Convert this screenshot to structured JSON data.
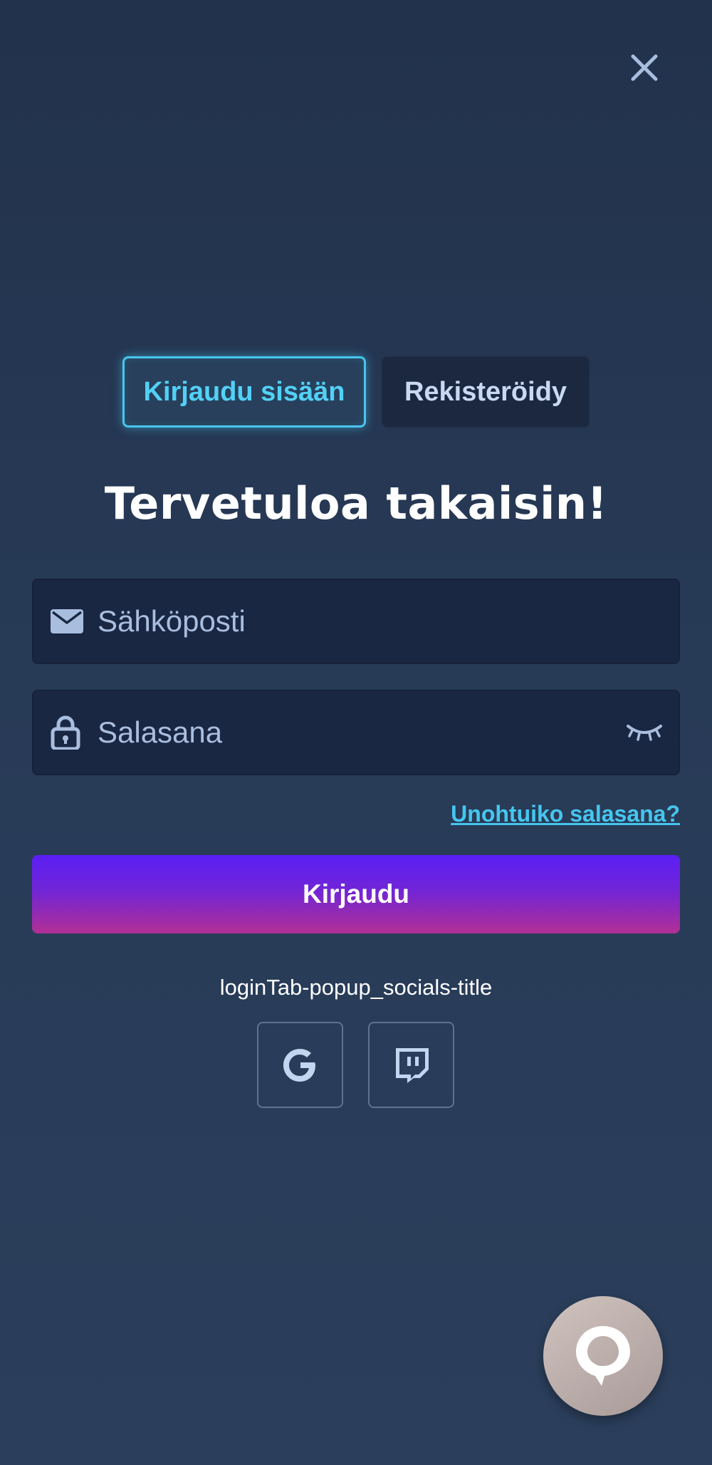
{
  "modal": {
    "close_icon": "close-icon"
  },
  "tabs": [
    {
      "label": "Kirjaudu sisään",
      "active": true
    },
    {
      "label": "Rekisteröidy",
      "active": false
    }
  ],
  "heading": "Tervetuloa takaisin!",
  "form": {
    "email": {
      "placeholder": "Sähköposti",
      "value": "",
      "icon": "envelope-icon"
    },
    "password": {
      "placeholder": "Salasana",
      "value": "",
      "icon": "lock-icon",
      "toggle_icon": "eye-closed-icon"
    },
    "forgot_label": "Unohtuiko salasana?",
    "submit_label": "Kirjaudu"
  },
  "socials": {
    "title": "loginTab-popup_socials-title",
    "providers": [
      {
        "icon": "google-icon"
      },
      {
        "icon": "twitch-icon"
      }
    ]
  },
  "chat": {
    "icon": "chat-icon"
  },
  "colors": {
    "accent": "#46c6ee",
    "button_gradient_top": "#5a1ef5",
    "button_gradient_bottom": "#b22f95",
    "background": "#253750",
    "input_bg": "#1a2742"
  }
}
